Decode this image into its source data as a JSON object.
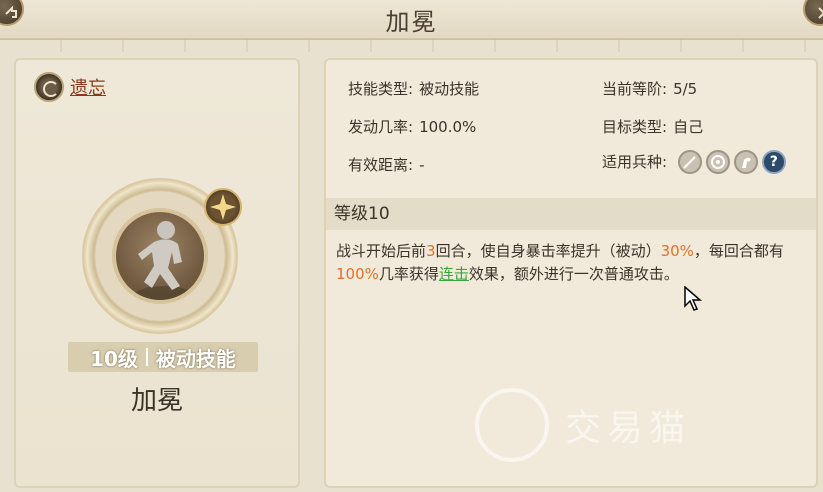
{
  "header": {
    "title": "加冕"
  },
  "left": {
    "forget_label": "遗忘",
    "level_label": "10级",
    "type_label": "被动技能",
    "skill_name": "加冕"
  },
  "info": {
    "skill_type_label": "技能类型:",
    "skill_type_value": "被动技能",
    "current_rank_label": "当前等阶:",
    "current_rank_value": "5/5",
    "trigger_rate_label": "发动几率:",
    "trigger_rate_value": "100.0%",
    "target_type_label": "目标类型:",
    "target_type_value": "自己",
    "range_label": "有效距离:",
    "range_value": "-",
    "troops_label": "适用兵种:",
    "troop_icons": [
      "sword-icon",
      "target-icon",
      "horse-icon",
      "question-icon"
    ]
  },
  "level_section": {
    "title": "等级10"
  },
  "description": {
    "p1": "战斗开始后前",
    "v1": "3",
    "p2": "回合，使自身暴击率提升（被动）",
    "v2": "30%",
    "p3": "，每回合都有",
    "v3": "100%",
    "p4": "几率获得",
    "v4": "连击",
    "p5": "效果，额外进行一次普通攻击。"
  },
  "watermark": {
    "text": "交易猫"
  },
  "colors": {
    "highlight_orange": "#e0702a",
    "highlight_green": "#3aa636",
    "forget_red": "#8a3a1c"
  }
}
